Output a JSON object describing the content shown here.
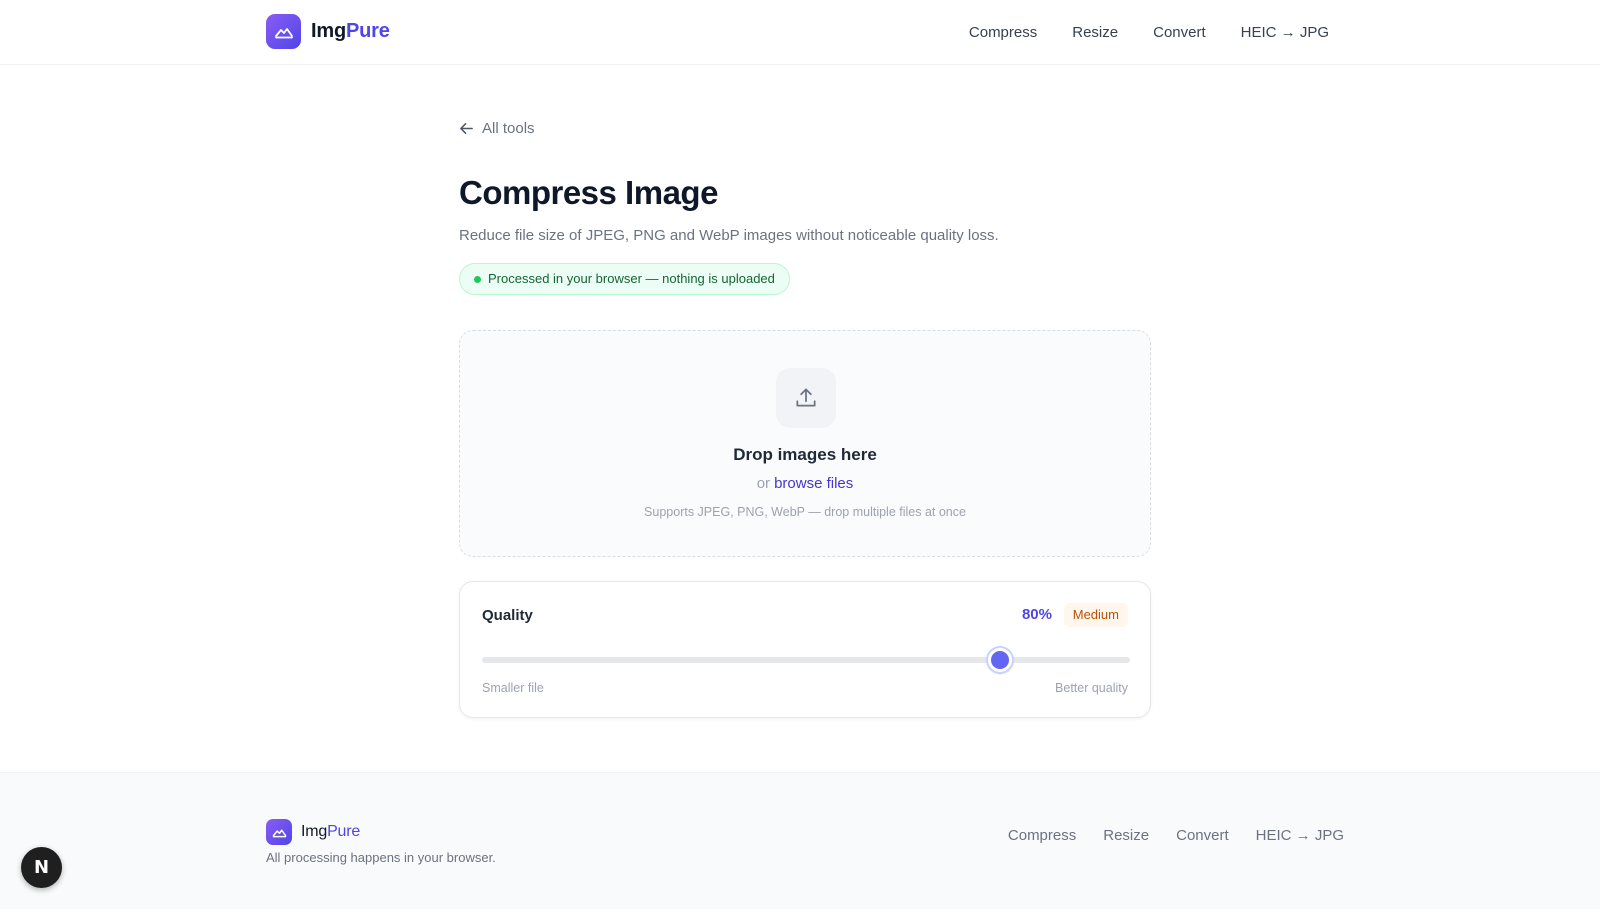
{
  "brand": {
    "name_plain": "Img",
    "name_accent": "Pure",
    "accent_color": "#4f46e5"
  },
  "nav": {
    "items": [
      {
        "label": "Compress"
      },
      {
        "label": "Resize"
      },
      {
        "label": "Convert"
      },
      {
        "label": "HEIC → JPG"
      }
    ]
  },
  "back_link": {
    "label": "All tools",
    "icon": "arrow-left-icon"
  },
  "page": {
    "title": "Compress Image",
    "subtitle": "Reduce file size of JPEG, PNG and WebP images without noticeable quality loss.",
    "privacy_badge": "Processed in your browser — nothing is uploaded"
  },
  "dropzone": {
    "icon": "upload-icon",
    "title": "Drop images here",
    "or": "or",
    "browse_label": "browse files",
    "hint": "Supports JPEG, PNG, WebP — drop multiple files at once"
  },
  "quality": {
    "label": "Quality",
    "value": 80,
    "value_label": "80%",
    "level": "Medium",
    "min_label": "Smaller file",
    "max_label": "Better quality"
  },
  "footer": {
    "tagline": "All processing happens in your browser.",
    "links": [
      {
        "label": "Compress"
      },
      {
        "label": "Resize"
      },
      {
        "label": "Convert"
      },
      {
        "label": "HEIC → JPG"
      }
    ]
  },
  "dev_badge": {
    "label": "N"
  }
}
